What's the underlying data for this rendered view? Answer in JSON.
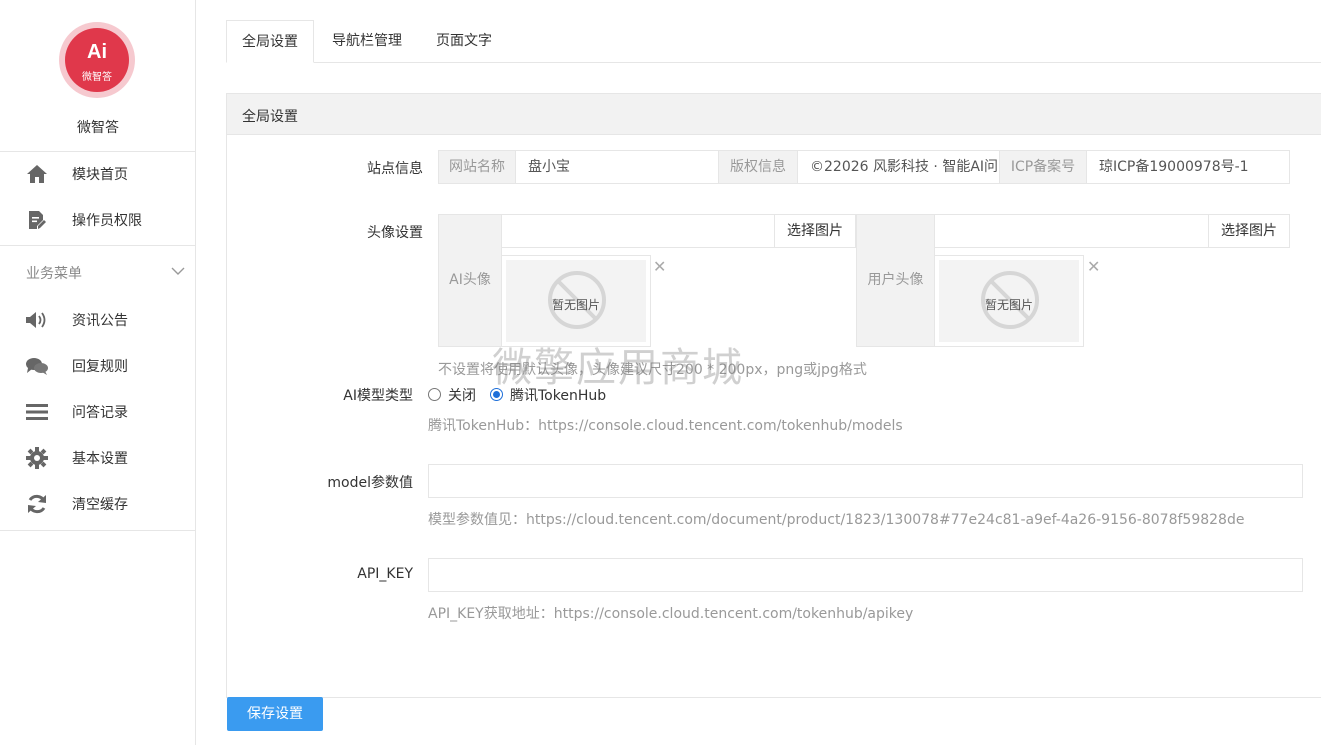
{
  "sidebar": {
    "logo_text": "Ai",
    "logo_sub": "微智答",
    "brand": "微智答",
    "top_items": [
      {
        "label": "模块首页",
        "icon": "home-icon"
      },
      {
        "label": "操作员权限",
        "icon": "document-edit-icon"
      }
    ],
    "group_label": "业务菜单",
    "group_items": [
      {
        "label": "资讯公告",
        "icon": "speaker-icon"
      },
      {
        "label": "回复规则",
        "icon": "chat-bubbles-icon"
      },
      {
        "label": "问答记录",
        "icon": "list-icon"
      },
      {
        "label": "基本设置",
        "icon": "gear-icon"
      },
      {
        "label": "清空缓存",
        "icon": "refresh-icon"
      }
    ]
  },
  "tabs": [
    {
      "label": "全局设置",
      "active": true
    },
    {
      "label": "导航栏管理",
      "active": false
    },
    {
      "label": "页面文字",
      "active": false
    }
  ],
  "panel": {
    "title": "全局设置",
    "site_info": {
      "label": "站点信息",
      "site_name_addon": "网站名称",
      "site_name_value": "盘小宝",
      "copyright_addon": "版权信息",
      "copyright_value": "©22026 风影科技 · 智能AI问",
      "icp_addon": "ICP备案号",
      "icp_value": "琼ICP备19000978号-1"
    },
    "avatar": {
      "label": "头像设置",
      "ai_addon": "AI头像",
      "user_addon": "用户头像",
      "choose_label": "选择图片",
      "no_image": "暂无图片",
      "help": "不设置将使用默认头像，头像建议尺寸200 * 200px，png或jpg格式"
    },
    "model_type": {
      "label": "AI模型类型",
      "options": [
        "关闭",
        "腾讯TokenHub"
      ],
      "selected": "腾讯TokenHub",
      "help": "腾讯TokenHub：https://console.cloud.tencent.com/tokenhub/models"
    },
    "model_param": {
      "label": "model参数值",
      "value": "",
      "help": "模型参数值见：https://cloud.tencent.com/document/product/1823/130078#77e24c81-a9ef-4a26-9156-8078f59828de"
    },
    "api_key": {
      "label": "API_KEY",
      "value": "",
      "help": "API_KEY获取地址：https://console.cloud.tencent.com/tokenhub/apikey"
    }
  },
  "watermark": "微擎应用商城",
  "save_label": "保存设置",
  "colors": {
    "brand_red": "#e0384b",
    "primary_blue": "#3a9bf0"
  }
}
